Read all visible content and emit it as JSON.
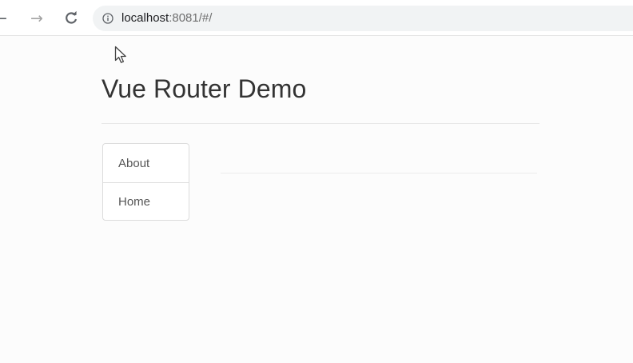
{
  "browser": {
    "back_icon": "arrow-left-icon",
    "forward_icon": "arrow-right-icon",
    "reload_icon": "reload-icon",
    "info_icon": "info-icon",
    "url_host": "localhost",
    "url_rest": ":8081/#/"
  },
  "page": {
    "cursor_icon": "mouse-pointer-icon",
    "title": "Vue Router Demo",
    "nav": {
      "items": [
        {
          "label": "About"
        },
        {
          "label": "Home"
        }
      ]
    }
  },
  "colors": {
    "title_text": "#333333",
    "link_text": "#555555",
    "border": "#dcdcdc"
  }
}
